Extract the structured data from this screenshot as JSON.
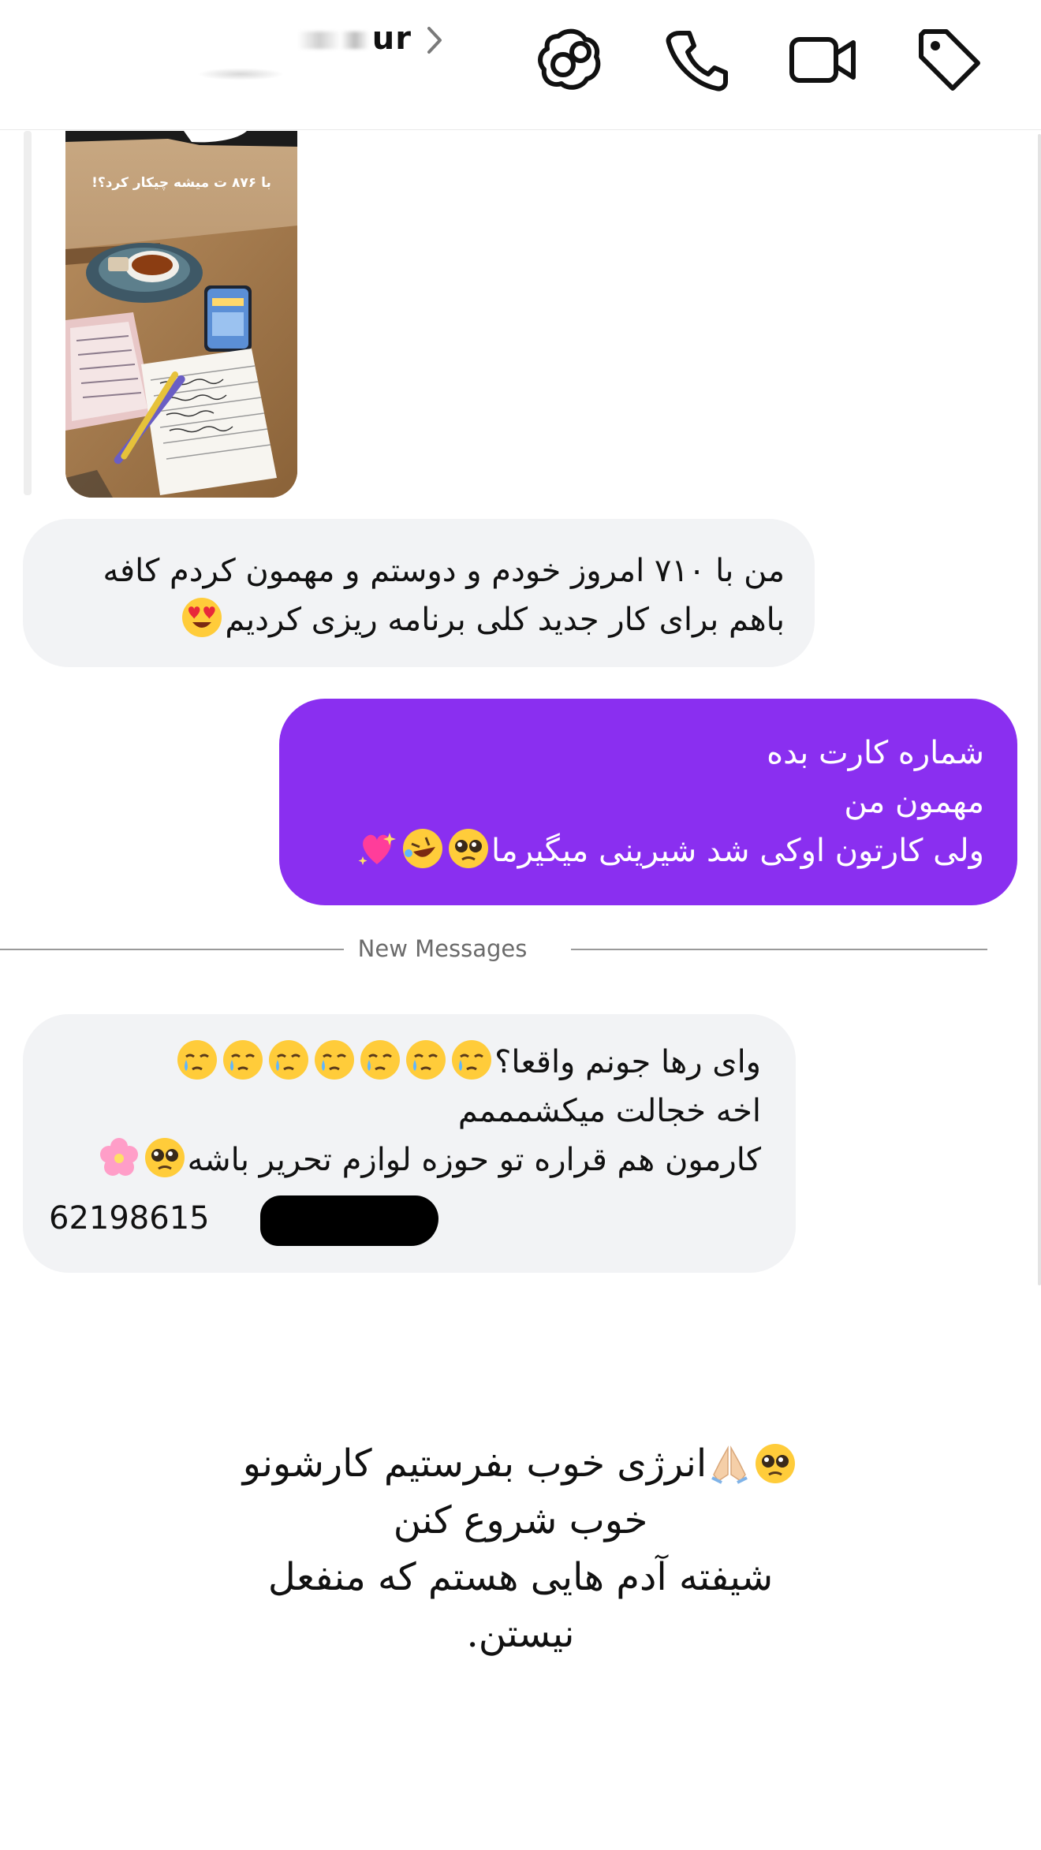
{
  "header": {
    "contact_name": "ur",
    "icons": [
      "chevron-right-icon",
      "group-faces-icon",
      "phone-icon",
      "video-camera-icon",
      "tag-icon"
    ]
  },
  "story_reply": {
    "caption": "با ۸۷۶ ت میشه چیکار کرد؟!"
  },
  "messages": [
    {
      "direction": "incoming",
      "lines": [
        "من با ۷۱۰ امروز خودم و دوستم و مهمون کردم کافه",
        "باهم برای کار جدید کلی برنامه ریزی کردیم"
      ]
    },
    {
      "direction": "outgoing",
      "lines": [
        "شماره کارت بده",
        "مهمون من",
        "ولی کارتون اوکی شد شیرینی میگیرما"
      ]
    },
    {
      "direction": "incoming",
      "lines": [
        "وای رها جونم واقعا؟",
        "اخه خجالت میکشمممم",
        "کارمون هم قراره  تو حوزه لوازم تحریر باشه",
        "62198615"
      ]
    }
  ],
  "new_messages_label": "New Messages",
  "caption_lines": [
    "انرژی خوب بفرستیم کارشونو",
    "خوب شروع کنن",
    "شیفته آدم هایی هستم که منفعل",
    "نیستن."
  ],
  "colors": {
    "outgoing_bubble": "#8a2ff0",
    "incoming_bubble": "#f2f3f5",
    "divider": "#9a9a9a"
  }
}
